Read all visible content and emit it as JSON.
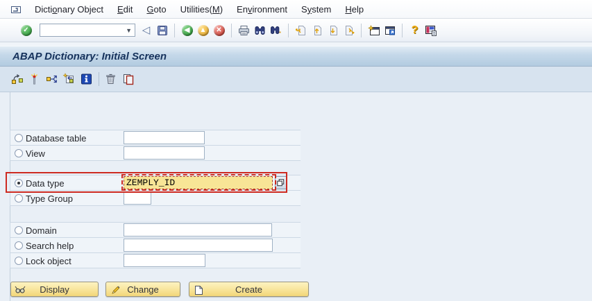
{
  "window": {
    "title": "ABAP Dictionary: Initial Screen"
  },
  "menu_bar": {
    "items": [
      {
        "label": "Dictionary Object",
        "underline_index": 5
      },
      {
        "label": "Edit",
        "underline_index": 0
      },
      {
        "label": "Goto",
        "underline_index": 0
      },
      {
        "label": "Utilities(M)",
        "underline_index": 10
      },
      {
        "label": "Environment",
        "underline_index": 2
      },
      {
        "label": "System",
        "underline_index": 1
      },
      {
        "label": "Help",
        "underline_index": 0
      }
    ]
  },
  "toolbar": {
    "command_field": {
      "value": "",
      "placeholder": ""
    },
    "icons": [
      "enter",
      "command-dropdown",
      "back-step",
      "save",
      "back",
      "exit",
      "cancel",
      "print",
      "find",
      "find-next",
      "first-page",
      "previous-page",
      "next-page",
      "last-page",
      "new-session",
      "create-shortcut",
      "help",
      "customize-layout"
    ]
  },
  "app_toolbar": {
    "icons": [
      "where-used-list",
      "activate-wand",
      "forward-navigation",
      "analysis",
      "information",
      "delete",
      "copy"
    ]
  },
  "form": {
    "rows": [
      {
        "label": "Database table",
        "value": "",
        "selected": false
      },
      {
        "label": "View",
        "value": "",
        "selected": false
      },
      {
        "label": "Data type",
        "value": "ZEMPLY_ID",
        "selected": true
      },
      {
        "label": "Type Group",
        "value": "",
        "selected": false
      },
      {
        "label": "Domain",
        "value": "",
        "selected": false
      },
      {
        "label": "Search help",
        "value": "",
        "selected": false
      },
      {
        "label": "Lock object",
        "value": "",
        "selected": false
      }
    ]
  },
  "buttons": {
    "display": "Display",
    "change": "Change",
    "create": "Create"
  },
  "colors": {
    "field_highlight": "#f8e596",
    "annotation_red": "#cd2a21",
    "title_text": "#16325c",
    "titlebar_gradient_top": "#e2ecf5",
    "titlebar_gradient_bottom": "#b2cbe0",
    "app_toolbar_bg": "#d7e3ef",
    "content_bg": "#e9eff6",
    "button_yellow": "#f8e49a"
  }
}
